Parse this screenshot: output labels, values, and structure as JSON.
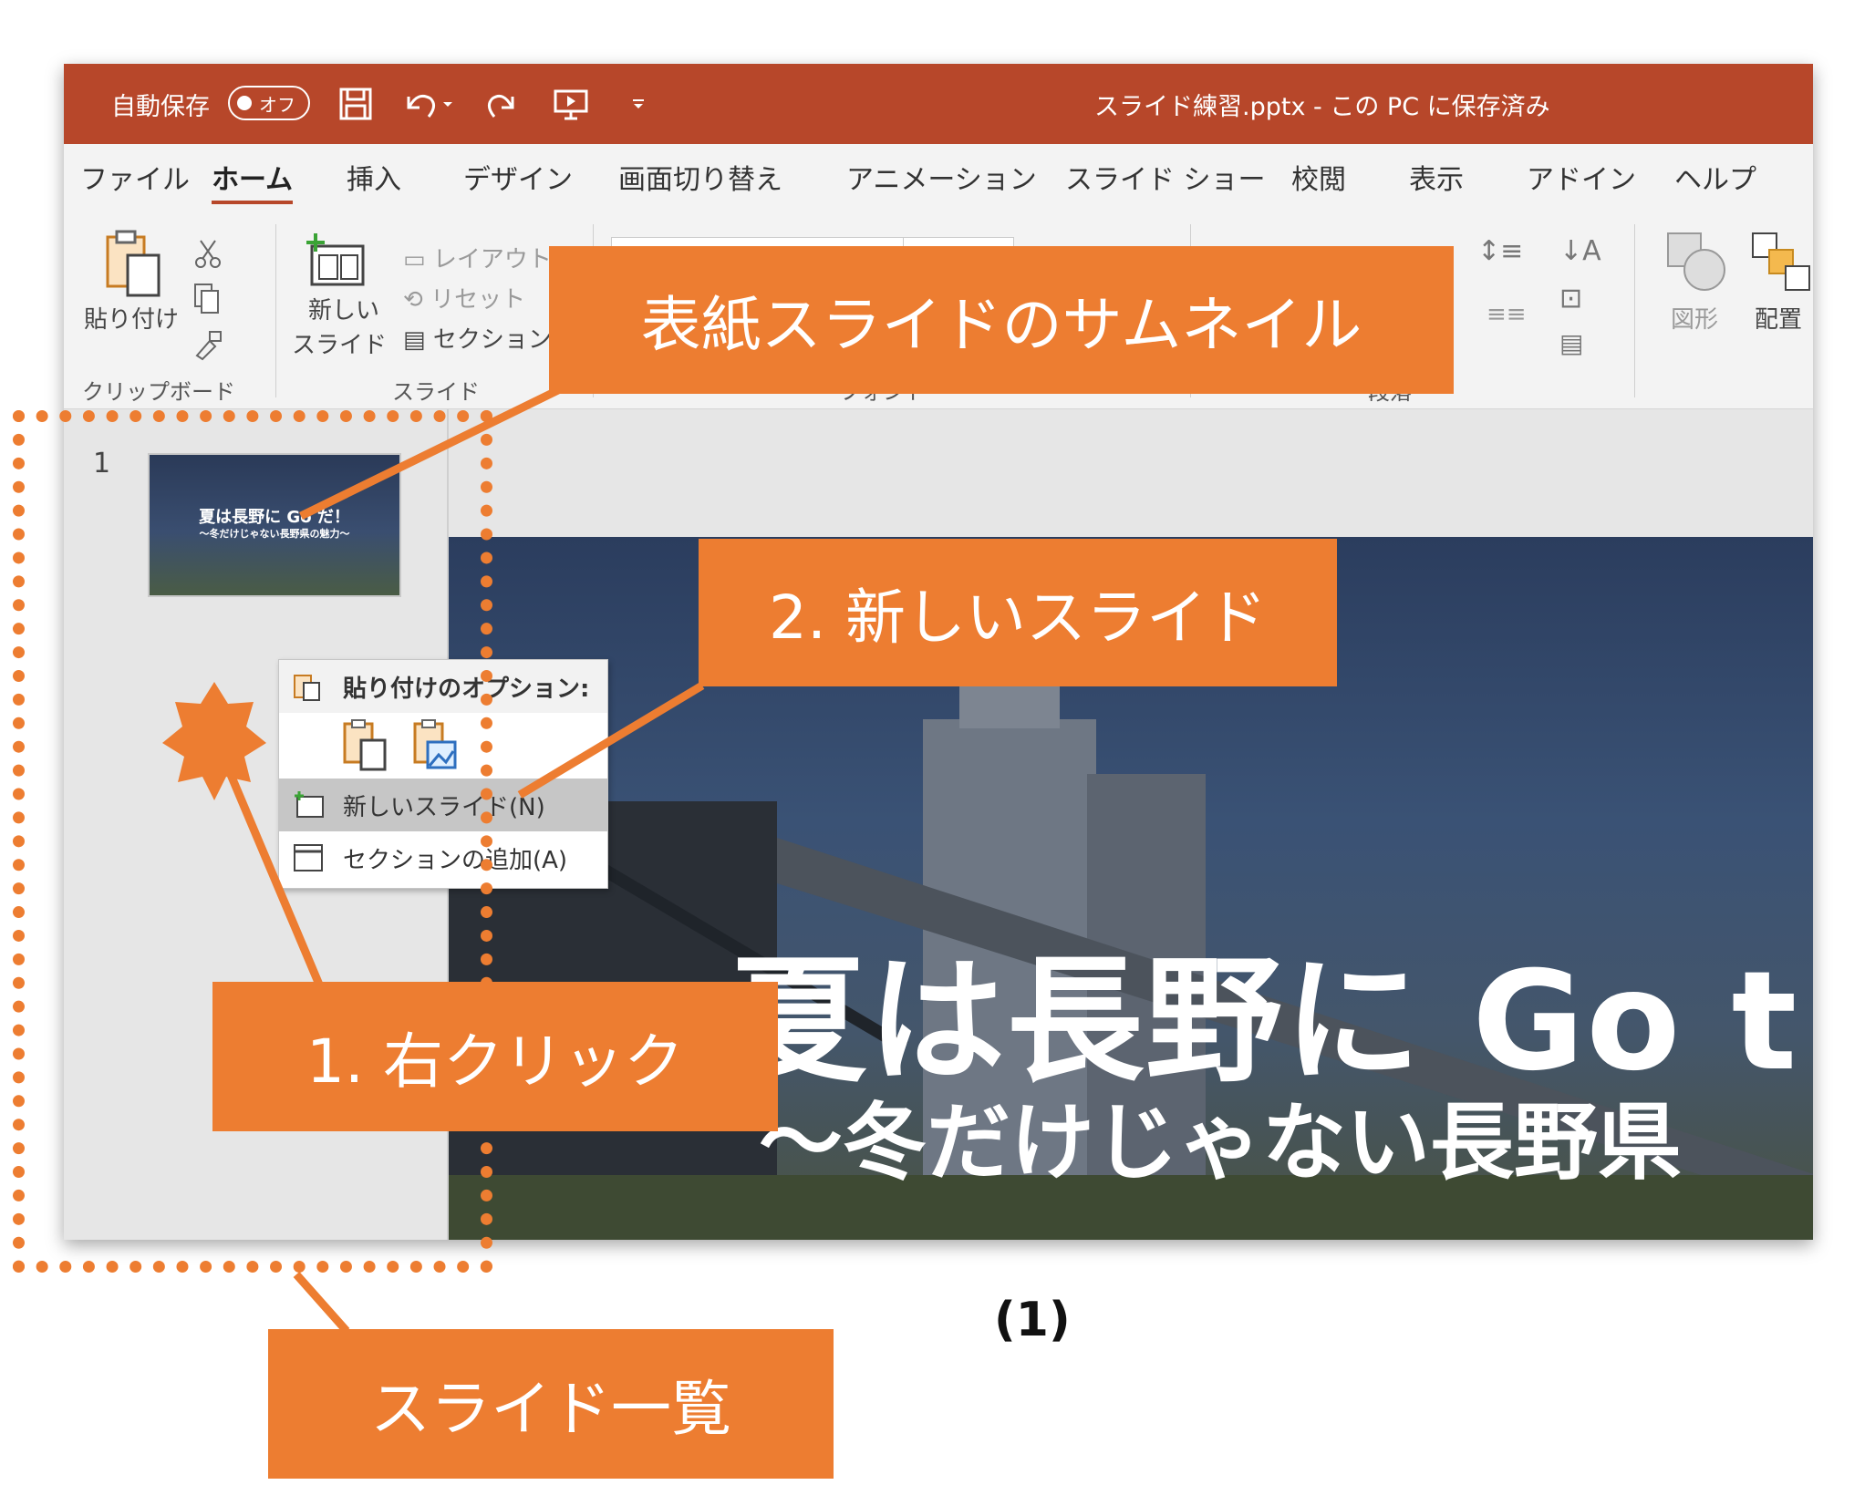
{
  "titlebar": {
    "autosave_label": "自動保存",
    "autosave_state": "オフ",
    "doc_title": "スライド練習.pptx  -  この PC に保存済み"
  },
  "tabs": [
    "ファイル",
    "ホーム",
    "挿入",
    "デザイン",
    "画面切り替え",
    "アニメーション",
    "スライド ショー",
    "校閲",
    "表示",
    "アドイン",
    "ヘルプ"
  ],
  "ribbon": {
    "paste": "貼り付け",
    "clipboard_group": "クリップボード",
    "new_slide_1": "新しい",
    "new_slide_2": "スライド",
    "layout": "レイアウト",
    "reset": "リセット",
    "section": "セクション",
    "slide_group": "スライド",
    "font_group": "フォント",
    "paragraph_group": "段落",
    "shapes": "図形",
    "arrange": "配置"
  },
  "slides_panel": {
    "slide_number": "1",
    "thumb_title": "夏は長野に Go だ！",
    "thumb_subtitle": "〜冬だけじゃない長野県の魅力〜"
  },
  "context_menu": {
    "header": "貼り付けのオプション:",
    "new_slide": "新しいスライド(N)",
    "add_section": "セクションの追加(A)"
  },
  "slide": {
    "title": "夏は長野に Go t",
    "subtitle": "〜冬だけじゃない長野県"
  },
  "annotations": {
    "thumbnail": "表紙スライドのサムネイル",
    "new_slide": "2. 新しいスライド",
    "right_click": "1. 右クリック",
    "slide_list": "スライド一覧",
    "caption": "(1)"
  },
  "colors": {
    "titlebar": "#b7472a",
    "callout": "#ed7d31",
    "ribbon": "#f3f3f3"
  }
}
